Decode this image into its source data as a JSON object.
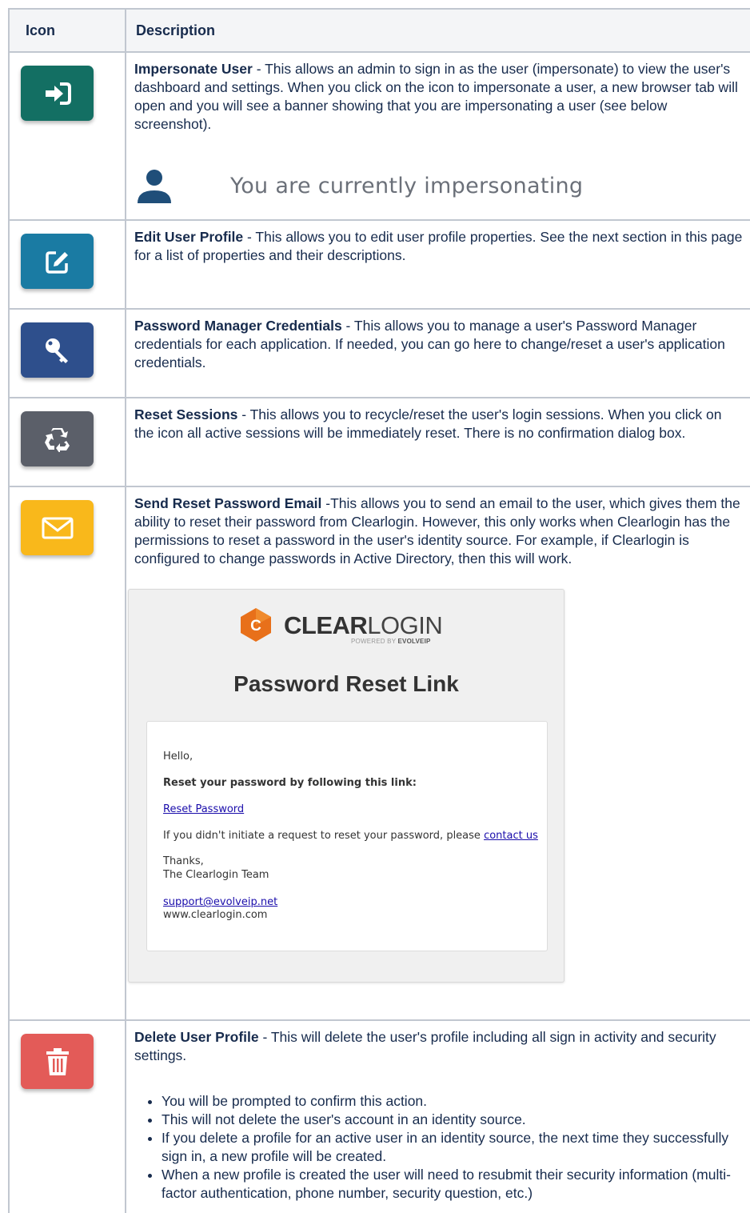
{
  "table": {
    "headers": [
      "Icon",
      "Description"
    ],
    "rows": [
      {
        "icon": "sign-in-icon",
        "icon_color": "#136f63",
        "title": "Impersonate User",
        "text": " - This allows an admin to sign in as the user (impersonate) to view the user's dashboard and settings.  When you click on the icon to impersonate a user, a new browser tab will open and you will see a banner showing that you are impersonating a user (see below screenshot)."
      },
      {
        "icon": "edit-icon",
        "icon_color": "#1a7ba3",
        "title": "Edit User Profile",
        "text": " - This allows you to edit user profile properties.  See the next section in this page for a list of properties and their descriptions."
      },
      {
        "icon": "key-icon",
        "icon_color": "#2e4f8c",
        "title": "Password Manager Credentials",
        "text": " - This allows you to manage a user's Password Manager credentials for each application.  If needed, you can go here to change/reset a user's application credentials."
      },
      {
        "icon": "recycle-icon",
        "icon_color": "#5b5f69",
        "title": "Reset Sessions",
        "text": " - This allows you to recycle/reset the user's login sessions.  When you click on the icon all active sessions will be immediately reset.  There is no confirmation dialog box."
      },
      {
        "icon": "envelope-icon",
        "icon_color": "#f9b81b",
        "title": "Send Reset Password Email",
        "text": " -This allows you to send an email to the user, which gives them the ability to reset their password from Clearlogin.  However, this only works when Clearlogin has the permissions to reset a password in the user's identity source.  For example, if Clearlogin is configured to change passwords in Active Directory, then this will work."
      },
      {
        "icon": "trash-icon",
        "icon_color": "#e35b58",
        "title": "Delete User Profile",
        "text": " - This will delete the user's profile including all sign in activity and security settings.",
        "bullets": [
          "You will be prompted to confirm this action.",
          "This will not delete the user's account in an identity source.",
          "If you delete a profile for an active user in an identity source, the next time they successfully sign in, a new profile will be created.",
          "When a new profile is created the user will need to resubmit their security information (multi-factor authentication, phone number, security question, etc.)"
        ]
      }
    ]
  },
  "impersonation_banner": {
    "icon": "person-icon",
    "text": "You are currently impersonating"
  },
  "email_screenshot": {
    "logo_bold": "CLEAR",
    "logo_light": "LOGIN",
    "logo_mark": "C",
    "powered_prefix": "POWERED BY ",
    "powered_brand": "EVOLVEIP",
    "title": "Password Reset Link",
    "greeting": "Hello,",
    "instruction": "Reset your password by following this link:",
    "reset_link": "Reset Password",
    "note_prefix": "If you didn't initiate a request to reset your password, please ",
    "contact_link": "contact us",
    "thanks": "Thanks,",
    "team": "The Clearlogin Team",
    "support_email": "support@evolveip.net",
    "website": "www.clearlogin.com"
  }
}
